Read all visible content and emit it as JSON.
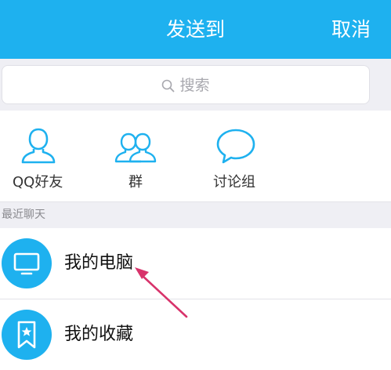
{
  "header": {
    "title": "发送到",
    "cancel_label": "取消"
  },
  "search": {
    "icon": "search-icon",
    "placeholder": "搜索"
  },
  "shortcuts": [
    {
      "label": "QQ好友",
      "icon": "person-icon"
    },
    {
      "label": "群",
      "icon": "group-icon"
    },
    {
      "label": "讨论组",
      "icon": "chat-bubble-icon"
    }
  ],
  "recent": {
    "label": "最近聊天",
    "items": [
      {
        "name": "我的电脑",
        "icon": "monitor-icon"
      },
      {
        "name": "我的收藏",
        "icon": "bookmark-star-icon"
      }
    ]
  },
  "colors": {
    "accent": "#1eb1ef",
    "background": "#efeff4",
    "annotation_arrow": "#d8336b"
  }
}
